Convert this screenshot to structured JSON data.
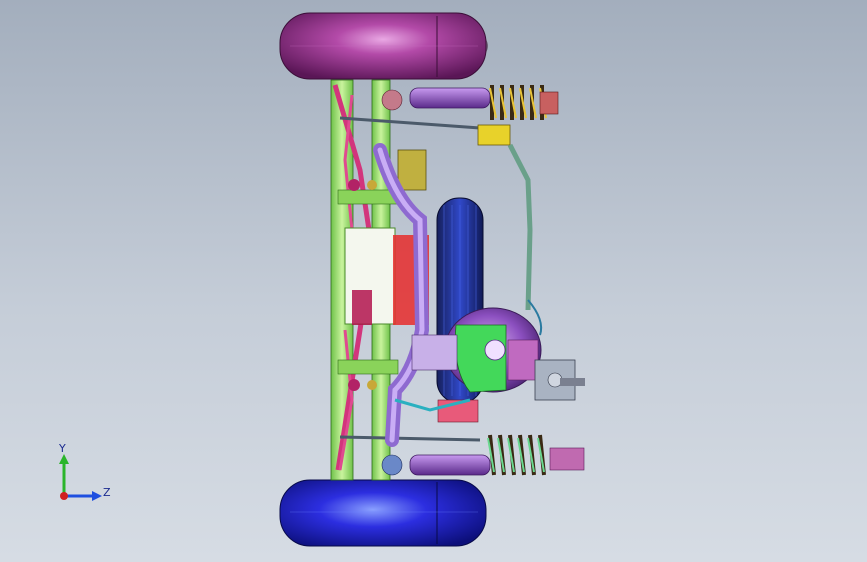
{
  "viewport": {
    "background_top": "#a3aebd",
    "background_bottom": "#d6dce4"
  },
  "model": {
    "description_icon": "cad-assembly-icon",
    "colors": {
      "top_tire": "#9b2f93",
      "bottom_tire": "#2a2fd0",
      "spare_tire": "#1f2f9c",
      "spring": "#3a2a14",
      "shock_body": "#7a3fb0",
      "frame_rail": "#a7e07a",
      "frame_accent": "#d2357c",
      "differential": "#6a3a9a",
      "diff_green": "#43d85a",
      "exhaust": "#a77fe0",
      "bracket_yellow": "#e8d22a"
    }
  },
  "triad": {
    "y_label": "Y",
    "z_label": "Z",
    "y_color": "#2bb52b",
    "z_color": "#1e4fe0",
    "x_color": "#d02020"
  }
}
